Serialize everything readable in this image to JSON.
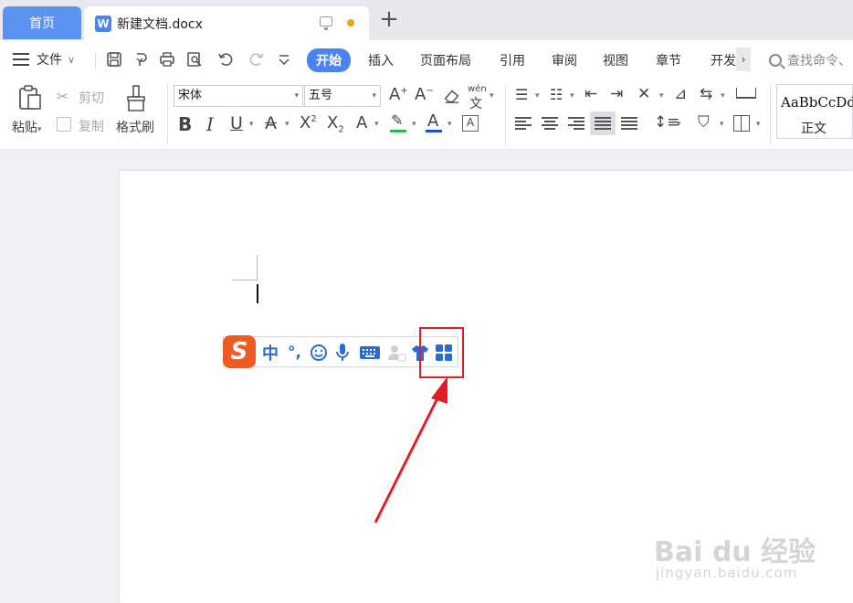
{
  "tabs": {
    "home_label": "首页",
    "doc_icon": "W",
    "doc_title": "新建文档.docx"
  },
  "menu": {
    "file_label": "文件",
    "tabs": [
      "开始",
      "插入",
      "页面布局",
      "引用",
      "审阅",
      "视图",
      "章节",
      "开发"
    ],
    "active_tab": "开始",
    "search_label": "查找命令、"
  },
  "ribbon": {
    "paste_label": "粘贴",
    "cut_label": "剪切",
    "copy_label": "复制",
    "format_painter_label": "格式刷",
    "font_name": "宋体",
    "font_size": "五号",
    "pinyin_label": "wén",
    "style_sample": "AaBbCcDd",
    "style_name": "正文"
  },
  "ime_toolbar": {
    "logo": "S",
    "mode": "中",
    "punct": "°,",
    "icons": [
      "emoji-icon",
      "microphone-icon",
      "keyboard-icon",
      "user-icon",
      "skin-icon",
      "toolbox-icon"
    ]
  },
  "watermark": {
    "main": "Bai du 经验",
    "sub": "jingyan.baidu.com"
  },
  "colors": {
    "accent": "#4b84f0",
    "ime_brand": "#f05a23",
    "ime_icon": "#2a6bd6",
    "annotation": "#e21f26",
    "highlight_underline": "#31b44b",
    "font_color_underline": "#1f4fd1"
  }
}
